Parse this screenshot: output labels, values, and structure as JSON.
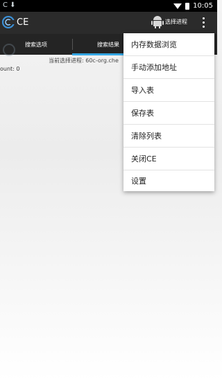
{
  "status_bar": {
    "time": "10:05",
    "left_text": "C ⬇"
  },
  "app_bar": {
    "title": "CE",
    "select_process_label": "选择进程"
  },
  "tabs": [
    {
      "label": "搜索选项"
    },
    {
      "label": "搜索结果"
    }
  ],
  "content": {
    "process_text": "当前选择进程: 60c-org.che",
    "count_text": "ount: 0"
  },
  "menu": {
    "items": [
      {
        "label": "内存数据浏览"
      },
      {
        "label": "手动添加地址"
      },
      {
        "label": "导入表"
      },
      {
        "label": "保存表"
      },
      {
        "label": "清除列表"
      },
      {
        "label": "关闭CE"
      },
      {
        "label": "设置"
      }
    ]
  },
  "colors": {
    "accent": "#35a6e3",
    "app_bar": "#2b2b2b",
    "tab_bar": "#242424"
  }
}
